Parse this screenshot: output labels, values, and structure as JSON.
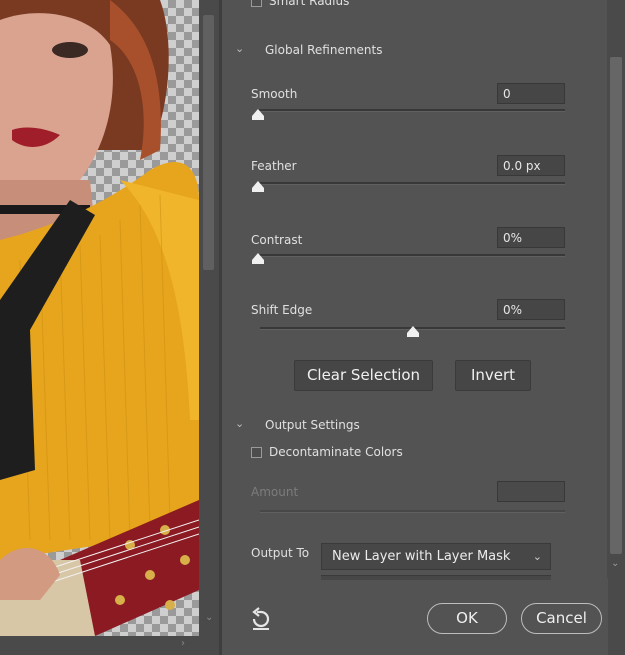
{
  "panel": {
    "smart_radius_label": "Smart Radius",
    "global_refinements": {
      "title": "Global Refinements",
      "smooth": {
        "label": "Smooth",
        "value": "0",
        "slider_fraction": 0.0
      },
      "feather": {
        "label": "Feather",
        "value": "0.0 px",
        "slider_fraction": 0.0
      },
      "contrast": {
        "label": "Contrast",
        "value": "0%",
        "slider_fraction": 0.0
      },
      "shift_edge": {
        "label": "Shift Edge",
        "value": "0%",
        "slider_fraction": 0.5
      }
    },
    "clear_selection_label": "Clear Selection",
    "invert_label": "Invert",
    "output_settings": {
      "title": "Output Settings",
      "decontaminate_label": "Decontaminate Colors",
      "decontaminate_checked": false,
      "amount_label": "Amount",
      "output_to_label": "Output To",
      "output_to_value": "New Layer with Layer Mask"
    },
    "ok_label": "OK",
    "cancel_label": "Cancel"
  },
  "icons": {
    "section_collapse": "chevron-down-icon",
    "reset": "reset-arrow-icon",
    "scroll_down": "chevron-down-icon",
    "scroll_right": "chevron-right-icon"
  },
  "colors": {
    "panel_bg": "#535353",
    "field_bg": "#464646",
    "text": "#e0e0e0",
    "dim_text": "#7c7c7c"
  }
}
